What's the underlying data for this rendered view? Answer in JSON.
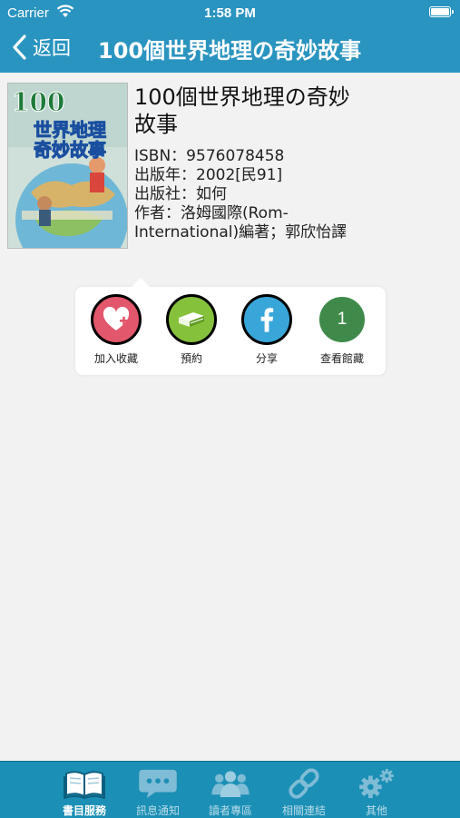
{
  "status_bar": {
    "carrier": "Carrier",
    "time": "1:58 PM"
  },
  "nav": {
    "back_label": "返回",
    "title": "100個世界地理の奇妙故事"
  },
  "book": {
    "title": "100個世界地理の奇妙故事",
    "isbn": "ISBN：9576078458",
    "year": "出版年：2002[民91]",
    "publisher": "出版社：如何",
    "author": "作者：洛姆國際(Rom-International)編著；郭欣怡譯",
    "cover_text": "100 世界地理の奇妙故事"
  },
  "actions": [
    {
      "label": "加入收藏",
      "icon": "heart-plus-icon"
    },
    {
      "label": "預約",
      "icon": "book-icon"
    },
    {
      "label": "分享",
      "icon": "facebook-icon"
    },
    {
      "label": "查看館藏",
      "icon": "count-badge",
      "count": "1"
    }
  ],
  "tabs": [
    {
      "label": "書目服務",
      "icon": "open-book-icon",
      "active": true
    },
    {
      "label": "訊息通知",
      "icon": "chat-bubble-icon",
      "active": false
    },
    {
      "label": "讀者專區",
      "icon": "users-icon",
      "active": false
    },
    {
      "label": "相關連結",
      "icon": "link-icon",
      "active": false
    },
    {
      "label": "其他",
      "icon": "gears-icon",
      "active": false
    }
  ],
  "colors": {
    "header": "#2a94c0",
    "tabbar": "#1b8fb5",
    "background": "#f2f2f2"
  }
}
